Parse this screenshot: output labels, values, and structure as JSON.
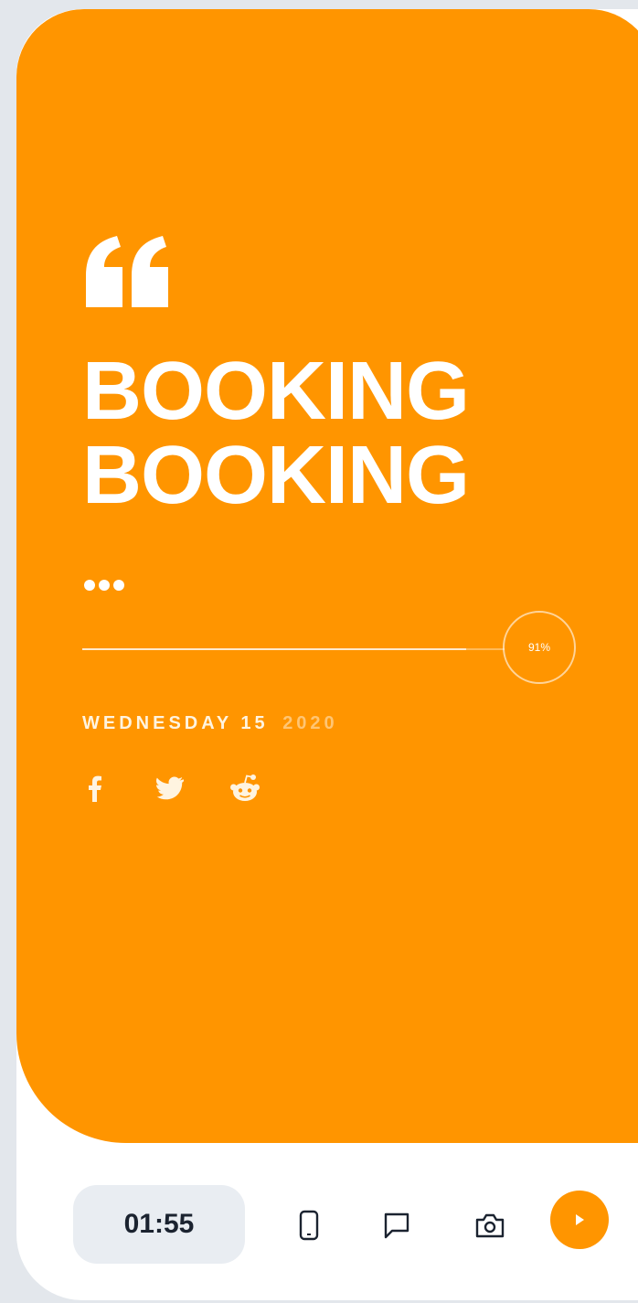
{
  "colors": {
    "accent": "#ff9500",
    "background": "#e3e7ec",
    "text_dark": "#1b2330",
    "timer_bg": "#e9edf2"
  },
  "card": {
    "quote_icon": "quote-icon",
    "headline_line1": "BOOKING",
    "headline_line2": "BOOKING",
    "more_icon": "ellipsis-icon",
    "progress": {
      "percent": 91,
      "label": "91%"
    },
    "date_label": "WEDNESDAY 15",
    "date_year": "2020",
    "social": [
      {
        "name": "facebook",
        "icon": "facebook-icon"
      },
      {
        "name": "twitter",
        "icon": "twitter-icon"
      },
      {
        "name": "reddit",
        "icon": "reddit-icon"
      }
    ]
  },
  "bottom_bar": {
    "timer": "01:55",
    "icons": [
      "phone-icon",
      "chat-icon",
      "camera-icon",
      "play-icon"
    ]
  }
}
